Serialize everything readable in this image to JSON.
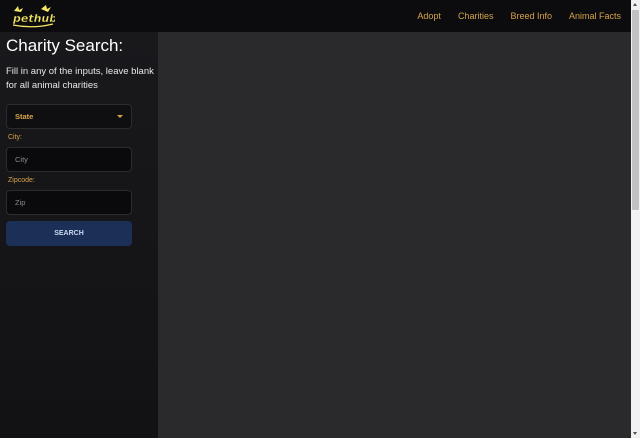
{
  "navbar": {
    "logo_text": "pethub",
    "links": [
      "Adopt",
      "Charities",
      "Breed Info",
      "Animal Facts"
    ]
  },
  "sidebar": {
    "title": "Charity Search:",
    "description": "Fill in any of the inputs, leave blank for all animal charities",
    "state_select": {
      "selected": "State"
    },
    "city": {
      "label": "City:",
      "placeholder": "City",
      "value": ""
    },
    "zipcode": {
      "label": "Zipcode:",
      "placeholder": "Zip",
      "value": ""
    },
    "search_button": "SEARCH"
  },
  "colors": {
    "accent": "#d5a34a",
    "navbar_bg": "#0c0c0f",
    "sidebar_bg": "#17171a",
    "main_bg": "#2a2a2d",
    "button_bg": "#1b2f57"
  }
}
